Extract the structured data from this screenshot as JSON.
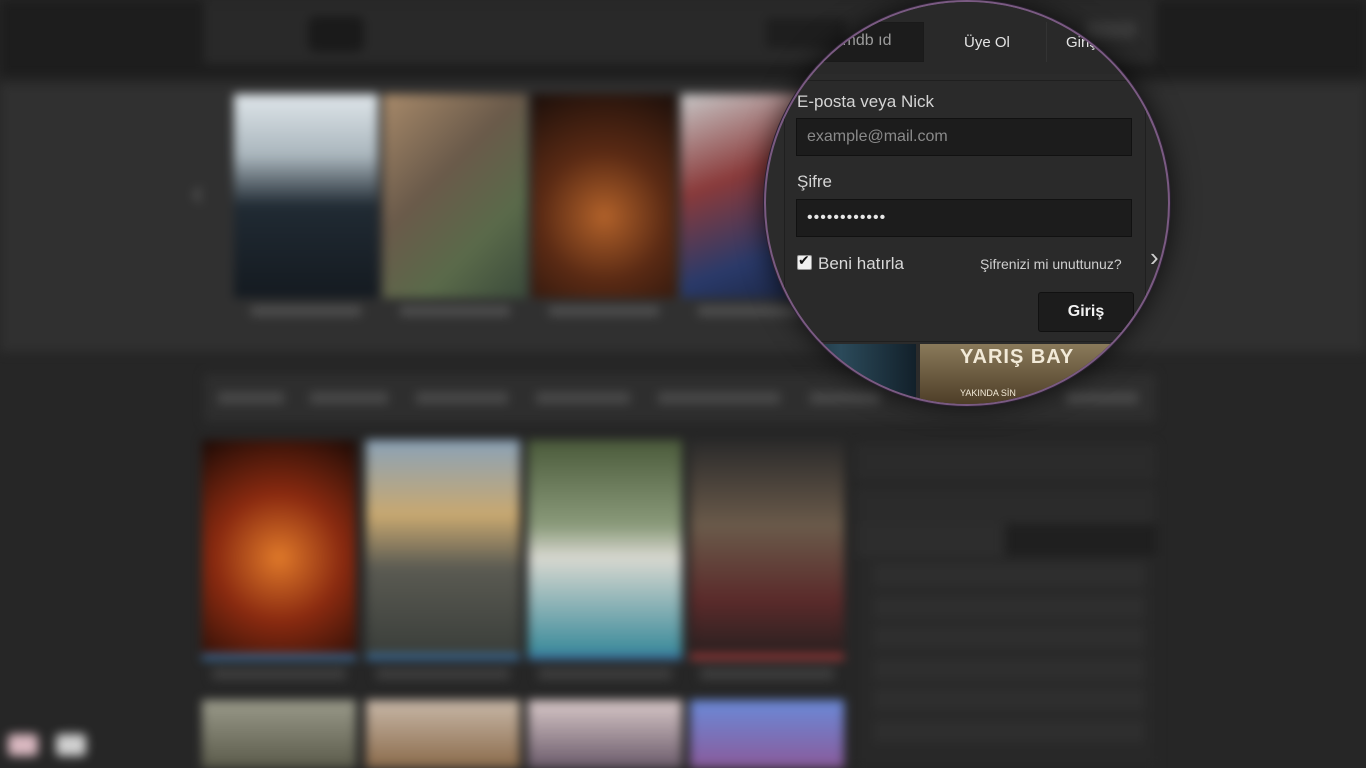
{
  "header": {
    "search_placeholder": "imdb ıd",
    "signup_label": "Üye Ol",
    "login_tab_label": "Giriş"
  },
  "login_form": {
    "email_label": "E-posta veya Nick",
    "email_placeholder": "example@mail.com",
    "password_label": "Şifre",
    "password_value": "••••••••••••",
    "remember_label": "Beni hatırla",
    "remember_checked": true,
    "forgot_label": "Şifrenizi mi unuttunuz?",
    "submit_label": "Giriş"
  },
  "lens_posters": {
    "poster_b_title": "YARIŞ BAY",
    "poster_b_tagline": "YAKINDA SİN"
  },
  "colors": {
    "background": "#262626",
    "panel": "#2a2a2a",
    "input": "#1c1c1c",
    "lens_border": "#7a5a82",
    "rating_bar": "#3a6fa0"
  },
  "icons": {
    "slider_prev": "chevron-left-icon",
    "slider_next": "chevron-right-icon",
    "remember_checkbox": "checkbox-checked-icon"
  }
}
